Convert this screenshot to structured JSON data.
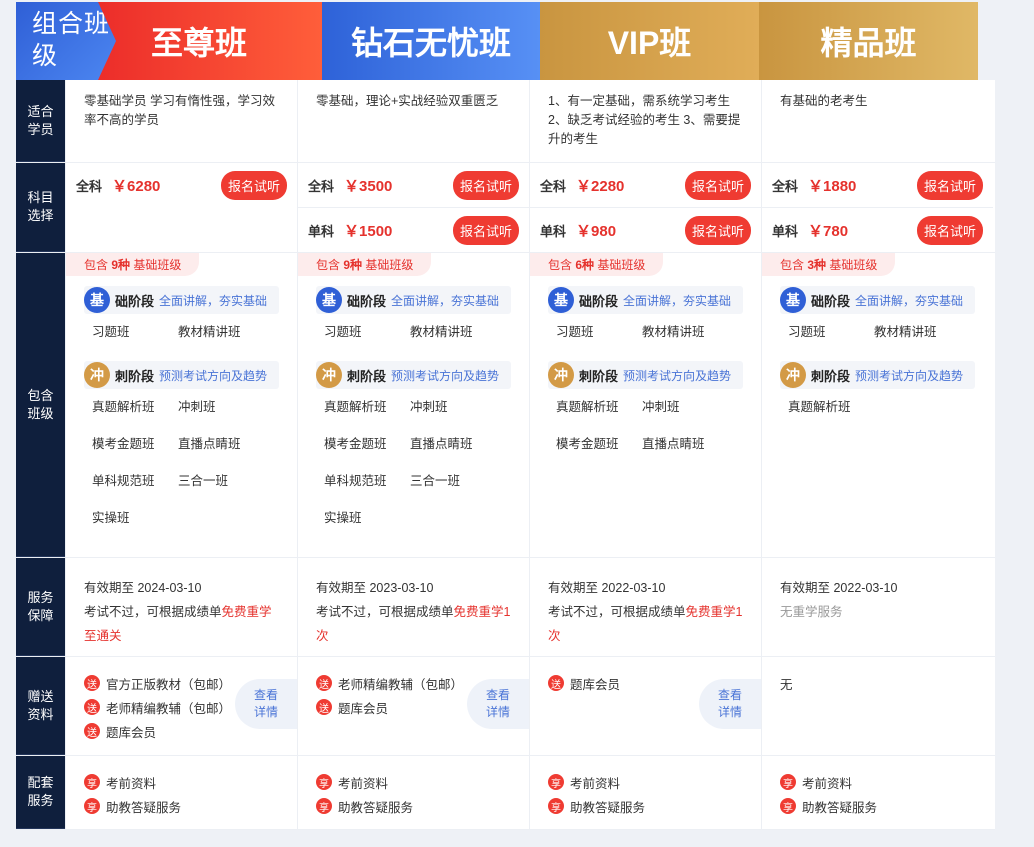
{
  "badge": "组合班级",
  "tiers": [
    "至尊班",
    "钻石无忧班",
    "VIP班",
    "精品班"
  ],
  "labels": {
    "suit": "适合学员",
    "subject": "科目选择",
    "include": "包含班级",
    "service": "服务保障",
    "gift": "赠送资料",
    "support": "配套服务"
  },
  "suit": [
    "零基础学员 学习有惰性强，学习效率不高的学员",
    "零基础，理论+实战经验双重匮乏",
    "1、有一定基础，需系统学习考生 2、缺乏考试经验的考生 3、需要提升的考生",
    "有基础的老考生"
  ],
  "prices": [
    {
      "full_label": "全科",
      "full": "￥6280",
      "single_label": "",
      "single": "",
      "btn": "报名试听"
    },
    {
      "full_label": "全科",
      "full": "￥3500",
      "single_label": "单科",
      "single": "￥1500",
      "btn": "报名试听"
    },
    {
      "full_label": "全科",
      "full": "￥2280",
      "single_label": "单科",
      "single": "￥980",
      "btn": "报名试听"
    },
    {
      "full_label": "全科",
      "full": "￥1880",
      "single_label": "单科",
      "single": "￥780",
      "btn": "报名试听"
    }
  ],
  "include": {
    "pre": "包含",
    "post": "基础班级",
    "stage1_icon": "基",
    "stage1_name": "础阶段",
    "stage1_desc": "全面讲解，夯实基础",
    "stage2_icon": "冲",
    "stage2_name": "刺阶段",
    "stage2_desc": "预测考试方向及趋势",
    "cols": [
      {
        "count": "9种",
        "s1": [
          "习题班",
          "教材精讲班"
        ],
        "s2": [
          "真题解析班",
          "冲刺班",
          "模考金题班",
          "直播点睛班",
          "单科规范班",
          "三合一班",
          "实操班"
        ]
      },
      {
        "count": "9种",
        "s1": [
          "习题班",
          "教材精讲班"
        ],
        "s2": [
          "真题解析班",
          "冲刺班",
          "模考金题班",
          "直播点睛班",
          "单科规范班",
          "三合一班",
          "实操班"
        ]
      },
      {
        "count": "6种",
        "s1": [
          "习题班",
          "教材精讲班"
        ],
        "s2": [
          "真题解析班",
          "冲刺班",
          "模考金题班",
          "直播点睛班"
        ]
      },
      {
        "count": "3种",
        "s1": [
          "习题班",
          "教材精讲班"
        ],
        "s2": [
          "真题解析班"
        ]
      }
    ]
  },
  "service": [
    {
      "valid": "有效期至 2024-03-10",
      "pre": "考试不过，可根据成绩单",
      "hl": "免费重学至通关"
    },
    {
      "valid": "有效期至 2023-03-10",
      "pre": "考试不过，可根据成绩单",
      "hl": "免费重学1次"
    },
    {
      "valid": "有效期至 2022-03-10",
      "pre": "考试不过，可根据成绩单",
      "hl": "免费重学1次"
    },
    {
      "valid": "有效期至 2022-03-10",
      "pre": "",
      "hl": "",
      "gray": "无重学服务"
    }
  ],
  "gift": {
    "icon": "送",
    "detail": "查看详情",
    "cols": [
      [
        "官方正版教材（包邮）",
        "老师精编教辅（包邮）",
        "题库会员"
      ],
      [
        "老师精编教辅（包邮）",
        "题库会员"
      ],
      [
        "题库会员"
      ],
      []
    ],
    "none": "无"
  },
  "support": {
    "icon": "享",
    "items": [
      "考前资料",
      "助教答疑服务"
    ]
  }
}
